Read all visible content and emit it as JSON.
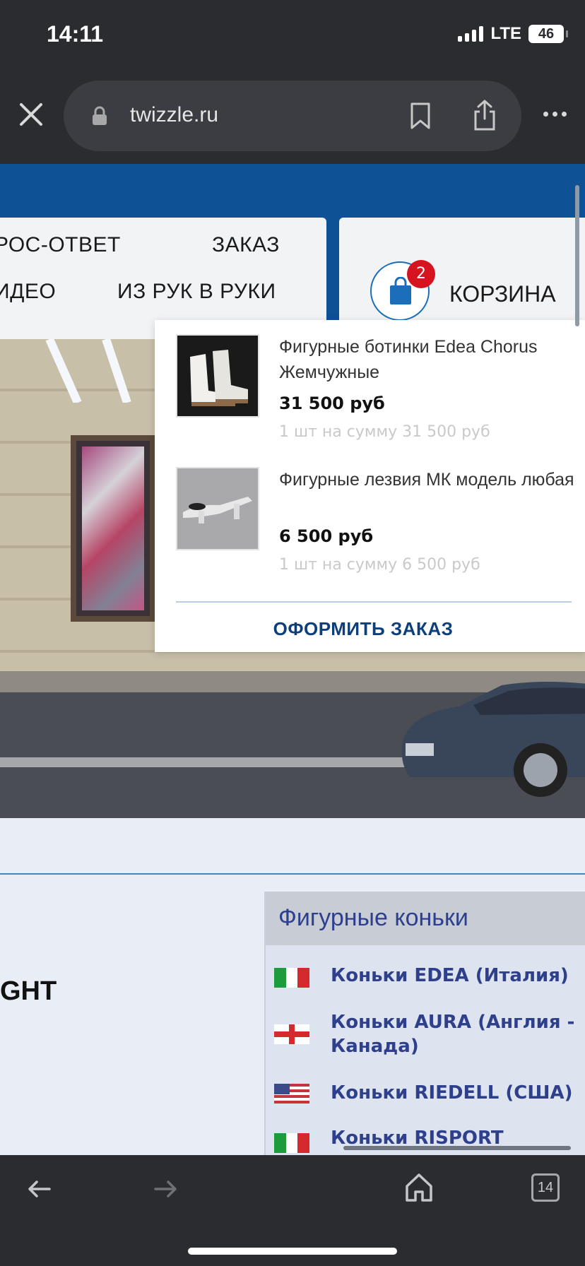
{
  "status_bar": {
    "time": "14:11",
    "network": "LTE",
    "battery": "46"
  },
  "browser": {
    "url": "twizzle.ru",
    "icons": [
      "close-icon",
      "lock-icon",
      "bookmark-icon",
      "share-icon",
      "more-icon"
    ]
  },
  "nav": {
    "items": [
      "РОС-ОТВЕТ",
      "ЗАКАЗ",
      "ИДЕО",
      "ИЗ РУК В РУКИ"
    ]
  },
  "cart": {
    "label": "КОРЗИНА",
    "count": "2"
  },
  "cart_dropdown": {
    "items": [
      {
        "name": "Фигурные ботинки Edea Chorus Жемчужные",
        "price": "31 500 руб",
        "summary": "1 шт на сумму 31 500 руб"
      },
      {
        "name": "Фигурные лезвия МК модель любая",
        "price": "6 500 руб",
        "summary": "1 шт на сумму 6 500 руб"
      }
    ],
    "checkout_label": "ОФОРМИТЬ ЗАКАЗ"
  },
  "content": {
    "left_fragment": "GHT"
  },
  "categories": {
    "title": "Фигурные коньки",
    "items": [
      {
        "label": "Коньки EDEA (Италия)",
        "flag": "italy"
      },
      {
        "label": "Коньки AURA (Англия - Канада)",
        "flag": "england"
      },
      {
        "label": "Коньки RIEDELL (США)",
        "flag": "usa"
      },
      {
        "label": "Коньки RISPORT",
        "flag": "italy"
      }
    ]
  },
  "toolbar": {
    "tab_count": "14"
  },
  "colors": {
    "brand_blue": "#0e5194",
    "link_blue": "#2e3f8c",
    "badge_red": "#d6141f"
  }
}
